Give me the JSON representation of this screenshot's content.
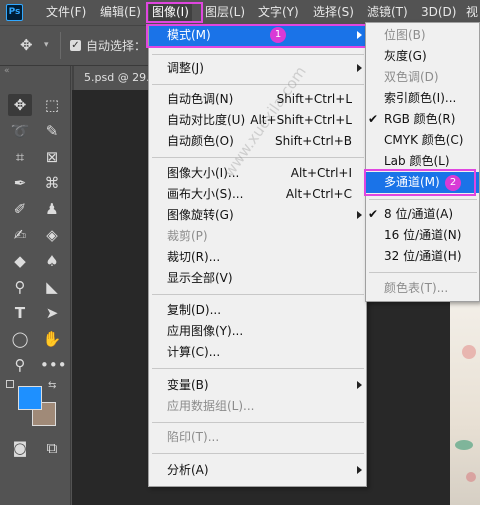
{
  "menubar": {
    "items": [
      "文件(F)",
      "编辑(E)",
      "图像(I)",
      "图层(L)",
      "文字(Y)",
      "选择(S)",
      "滤镜(T)",
      "3D(D)",
      "视"
    ]
  },
  "optbar": {
    "auto_select_label": "自动选择："
  },
  "document_tab": "5.psd @ 29.",
  "image_menu": {
    "mode": "模式(M)",
    "adjust": "调整(J)",
    "auto_tone": "自动色调(N)",
    "auto_tone_sc": "Shift+Ctrl+L",
    "auto_contrast": "自动对比度(U)",
    "auto_contrast_sc": "Alt+Shift+Ctrl+L",
    "auto_color": "自动颜色(O)",
    "auto_color_sc": "Shift+Ctrl+B",
    "image_size": "图像大小(I)...",
    "image_size_sc": "Alt+Ctrl+I",
    "canvas_size": "画布大小(S)...",
    "canvas_size_sc": "Alt+Ctrl+C",
    "rotation": "图像旋转(G)",
    "crop": "裁剪(P)",
    "trim": "裁切(R)...",
    "reveal_all": "显示全部(V)",
    "duplicate": "复制(D)...",
    "apply_image": "应用图像(Y)...",
    "calculations": "计算(C)...",
    "variables": "变量(B)",
    "apply_data_set": "应用数据组(L)...",
    "trap": "陷印(T)...",
    "analysis": "分析(A)"
  },
  "mode_submenu": {
    "bitmap": "位图(B)",
    "grayscale": "灰度(G)",
    "duotone": "双色调(D)",
    "indexed": "索引颜色(I)...",
    "rgb": "RGB 颜色(R)",
    "cmyk": "CMYK 颜色(C)",
    "lab": "Lab 颜色(L)",
    "multichannel": "多通道(M)",
    "bits8": "8 位/通道(A)",
    "bits16": "16 位/通道(N)",
    "bits32": "32 位/通道(H)",
    "color_table": "颜色表(T)...",
    "check_mark": "✔"
  },
  "badges": {
    "one": "1",
    "two": "2"
  },
  "watermark": "www.xuexila.com",
  "colors": {
    "highlight": "#1a73e8",
    "annotation": "#e046e0",
    "foreground": "#1e90ff",
    "background": "#a08a78"
  }
}
